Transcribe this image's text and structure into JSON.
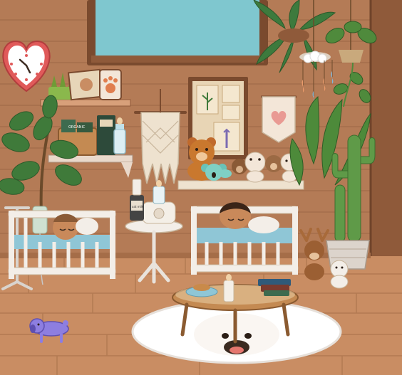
{
  "scene": {
    "room": "nursery",
    "jar_label": "oat milk",
    "tin_label": "ORGANIC",
    "wall_colors": {
      "wood": "#b47b56",
      "dark_wood": "#8f5a3a",
      "floor": "#c98d63",
      "window": "#7fc7cf",
      "rug": "#ffffff"
    }
  },
  "objects": [
    {
      "id": "window",
      "name": "window"
    },
    {
      "id": "heart-clock",
      "name": "heart-shaped clock"
    },
    {
      "id": "shelf-left",
      "name": "wall shelf with plants, books and baby bottle"
    },
    {
      "id": "macrame",
      "name": "macrame wall hanging"
    },
    {
      "id": "botanical-art",
      "name": "framed botanical prints"
    },
    {
      "id": "heart-banner",
      "name": "heart pennant banner"
    },
    {
      "id": "hanging-plants",
      "name": "hanging ferns and plants"
    },
    {
      "id": "mobile",
      "name": "cloud and raindrop mobile"
    },
    {
      "id": "shelf-right",
      "name": "toy shelf with teddy bears"
    },
    {
      "id": "crib-left",
      "name": "left crib with sleeping baby"
    },
    {
      "id": "crib-right",
      "name": "right crib with sleeping baby"
    },
    {
      "id": "side-table",
      "name": "side table with bottle warmer"
    },
    {
      "id": "iv-stand",
      "name": "IV drip stand"
    },
    {
      "id": "cactus",
      "name": "potted cactus and banana plant"
    },
    {
      "id": "fig-tree",
      "name": "fiddle leaf fig tree"
    },
    {
      "id": "coffee-table",
      "name": "round coffee table"
    },
    {
      "id": "rug",
      "name": "fluffy seal face rug"
    },
    {
      "id": "toy-dog",
      "name": "purple toy dog"
    },
    {
      "id": "plush-moose",
      "name": "plush moose toys"
    }
  ]
}
